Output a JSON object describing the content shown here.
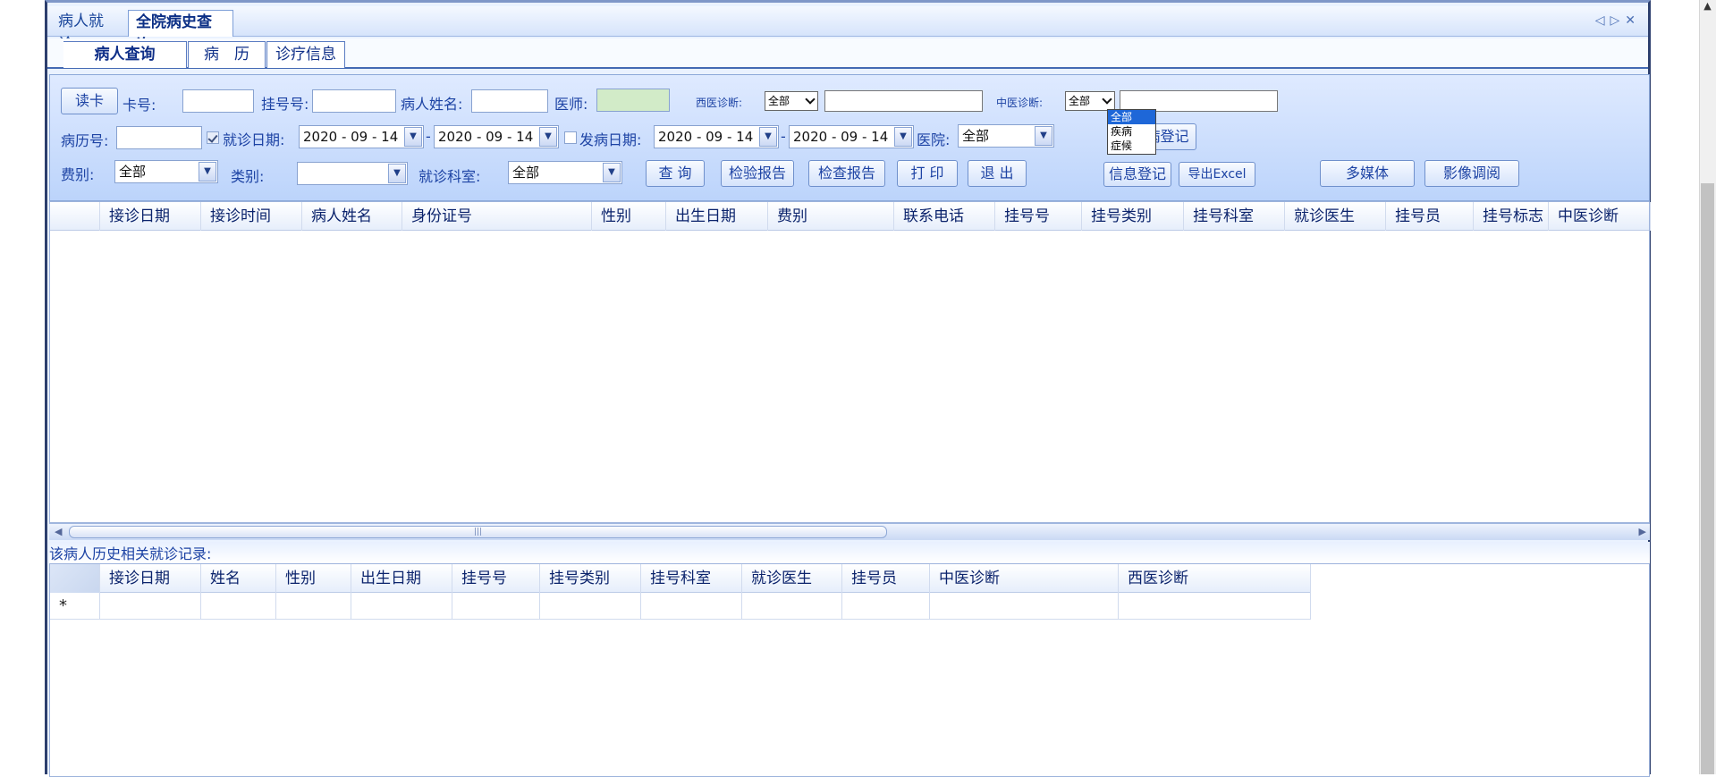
{
  "tabs": {
    "tab1": "病人就诊",
    "tab2": "全院病史查询"
  },
  "nav_icons": [
    "triangle-left-icon",
    "triangle-right-icon",
    "close-icon"
  ],
  "subtabs": {
    "query": "病人查询",
    "history": "病　历",
    "info": "诊疗信息"
  },
  "filter": {
    "read_card": "读卡",
    "card_no": "卡号:",
    "reg_no": "挂号号:",
    "patient_name": "病人姓名:",
    "doctor": "医师:",
    "western_diag": "西医诊断:",
    "western_select": "全部",
    "tcm_diag": "中医诊断:",
    "tcm_select": "全部",
    "record_no": "病历号:",
    "visit_date": "就诊日期:",
    "visit_from": "2020 - 09 - 14",
    "visit_to": "2020 - 09 - 14",
    "onset_date": "发病日期:",
    "onset_from": "2020 - 09 - 14",
    "onset_to": "2020 - 09 - 14",
    "hospital": "医院:",
    "hospital_value": "全部",
    "infect_btn": "传染病登记",
    "fee_type": "费别:",
    "fee_value": "全部",
    "category": "类别:",
    "dept": "就诊科室:",
    "dept_value": "全部",
    "query_btn": "查 询",
    "lab_btn": "检验报告",
    "exam_btn": "检查报告",
    "print_btn": "打 印",
    "exit_btn": "退 出",
    "info_btn": "信息登记",
    "excel_btn": "导出Excel",
    "media_btn": "多媒体",
    "image_btn": "影像调阅"
  },
  "tcm_dropdown_options": [
    "全部",
    "疾病",
    "症候"
  ],
  "main_grid_headers": [
    "接诊日期",
    "接诊时间",
    "病人姓名",
    "身份证号",
    "性别",
    "出生日期",
    "费别",
    "联系电话",
    "挂号号",
    "挂号类别",
    "挂号科室",
    "就诊医生",
    "挂号员",
    "挂号标志",
    "中医诊断"
  ],
  "history_label": "该病人历史相关就诊记录:",
  "history_grid_headers": [
    "接诊日期",
    "姓名",
    "性别",
    "出生日期",
    "挂号号",
    "挂号类别",
    "挂号科室",
    "就诊医生",
    "挂号员",
    "中医诊断",
    "西医诊断"
  ],
  "history_new_row_marker": "*"
}
